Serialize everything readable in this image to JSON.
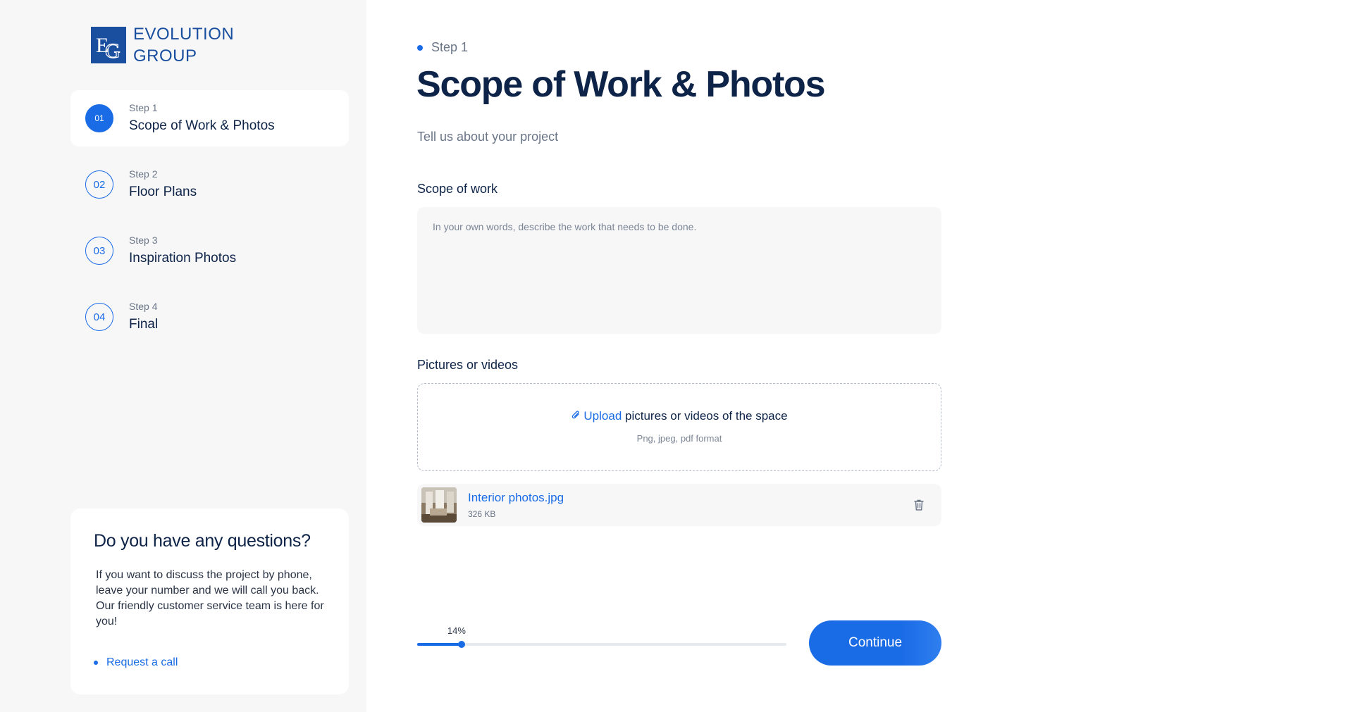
{
  "brand": {
    "name_line1": "EVOLUTION",
    "name_line2": "GROUP",
    "color": "#1a4fa0"
  },
  "sidebar": {
    "steps": [
      {
        "number": "01",
        "small": "Step 1",
        "title": "Scope of Work & Photos",
        "active": true
      },
      {
        "number": "02",
        "small": "Step 2",
        "title": "Floor Plans",
        "active": false
      },
      {
        "number": "03",
        "small": "Step 3",
        "title": "Inspiration Photos",
        "active": false
      },
      {
        "number": "04",
        "small": "Step 4",
        "title": "Final",
        "active": false
      }
    ],
    "help": {
      "title": "Do you have any questions?",
      "body": "If you want to discuss the project by phone, leave your number and we will call you back. Our friendly customer service team is here for you!",
      "link": "Request a call"
    }
  },
  "main": {
    "step_indicator": "Step 1",
    "title": "Scope of Work & Photos",
    "subtitle": "Tell us about your project",
    "scope": {
      "label": "Scope of work",
      "placeholder": "In your own words, describe the work that needs to be done.",
      "value": ""
    },
    "media": {
      "label": "Pictures or videos",
      "upload_link": "Upload",
      "upload_text": " pictures or videos of the space",
      "formats": "Png, jpeg, pdf format"
    },
    "file": {
      "name": "Interior photos.jpg",
      "size": "326 KB",
      "icon": "trash-icon"
    },
    "progress": {
      "label": "14%",
      "value": 0.12
    },
    "continue_label": "Continue"
  },
  "colors": {
    "accent": "#1a6be6",
    "navy": "#0d2347",
    "sidebar_bg": "#f7f7f8"
  }
}
